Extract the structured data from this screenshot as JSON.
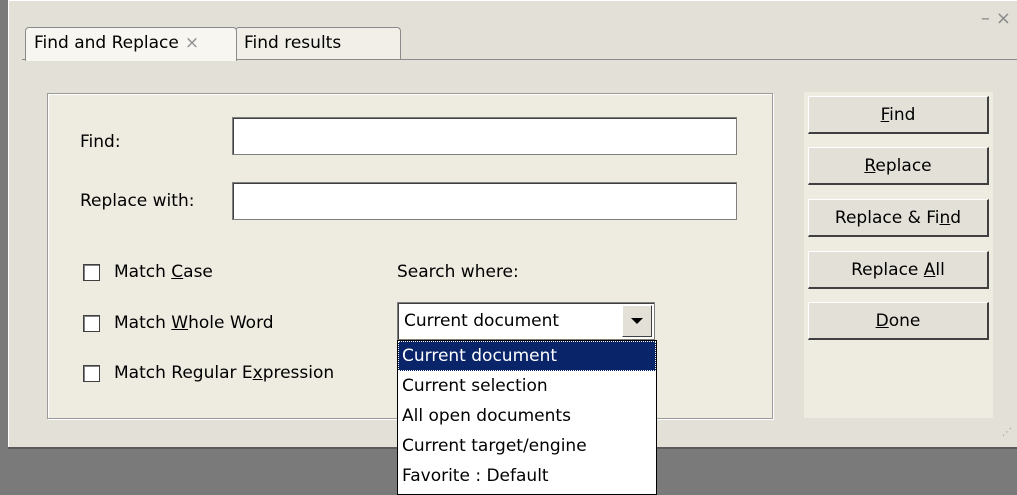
{
  "window": {
    "minimize_glyph": "–",
    "close_glyph": "×"
  },
  "tabs": [
    {
      "label": "Find and Replace",
      "close_glyph": "×"
    },
    {
      "label": "Find results"
    }
  ],
  "form": {
    "find_label": "Find:",
    "find_value": "",
    "replace_label": "Replace with:",
    "replace_value": "",
    "options": [
      {
        "pre": "Match ",
        "accel": "C",
        "post": "ase",
        "checked": false
      },
      {
        "pre": "Match ",
        "accel": "W",
        "post": "hole Word",
        "checked": false
      },
      {
        "pre": "Match Regular E",
        "accel": "x",
        "post": "pression",
        "checked": false
      }
    ],
    "search_where_label": "Search where:",
    "search_where_value": "Current document",
    "search_where_options": [
      "Current document",
      "Current selection",
      "All open documents",
      "Current target/engine",
      "Favorite : Default"
    ]
  },
  "buttons": {
    "find": {
      "pre": "",
      "accel": "F",
      "post": "ind"
    },
    "replace": {
      "pre": "",
      "accel": "R",
      "post": "eplace"
    },
    "replace_find": {
      "pre": "Replace & Fi",
      "accel": "n",
      "post": "d"
    },
    "replace_all": {
      "pre": "Replace ",
      "accel": "A",
      "post": "ll"
    },
    "done": {
      "pre": "",
      "accel": "D",
      "post": "one"
    }
  },
  "colors": {
    "panel_bg": "#e3e0d8",
    "selection_bg": "#0a246a"
  }
}
